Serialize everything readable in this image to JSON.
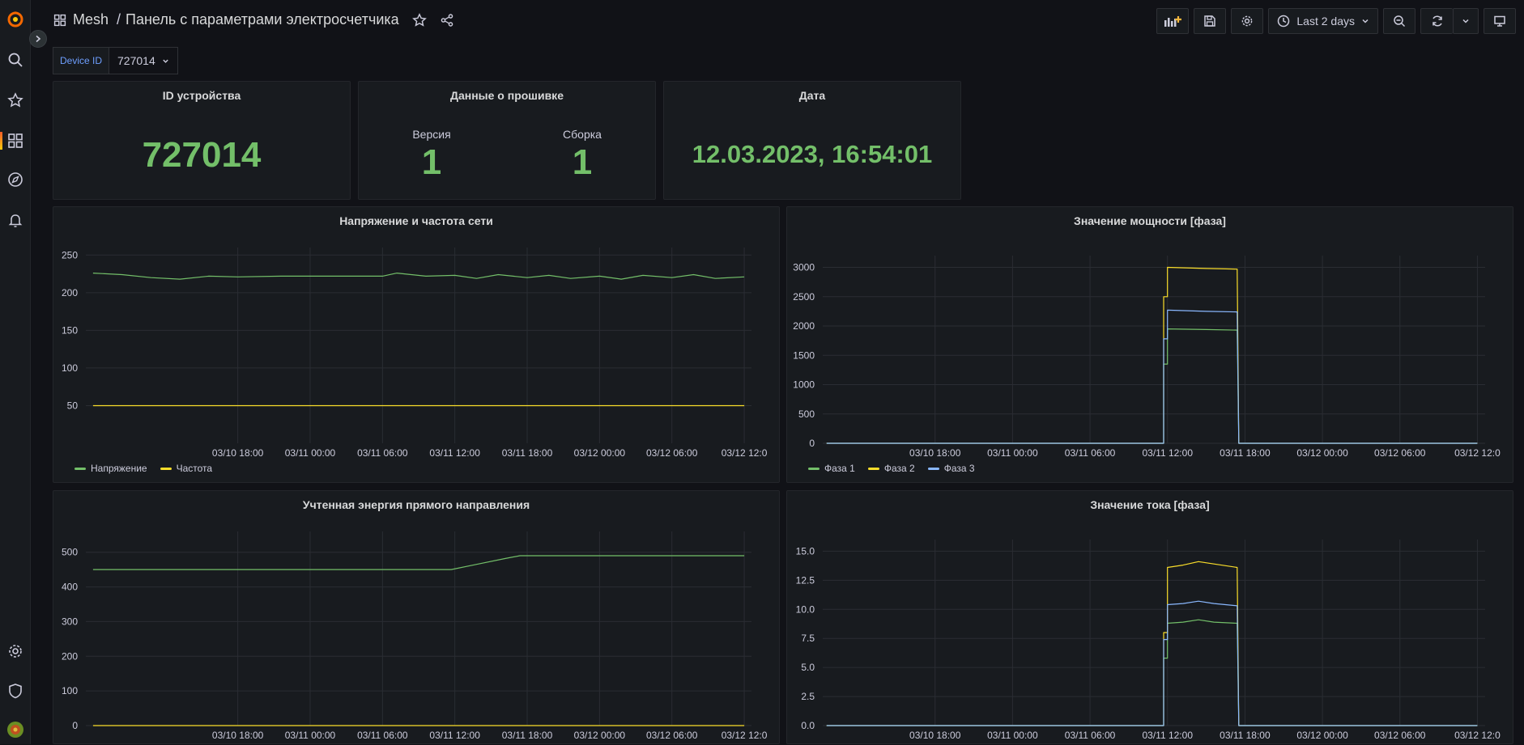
{
  "sidebar": {
    "items": [
      {
        "icon": "search-icon"
      },
      {
        "icon": "star-icon"
      },
      {
        "icon": "dashboards-icon"
      },
      {
        "icon": "explore-icon"
      },
      {
        "icon": "bell-icon"
      },
      {
        "icon": "gear-icon"
      },
      {
        "icon": "shield-icon"
      },
      {
        "icon": "avatar"
      }
    ]
  },
  "header": {
    "folder": "Mesh",
    "separator": "/",
    "title": "Панель с параметрами электросчетчика",
    "time_range": "Last 2 days"
  },
  "variables": {
    "label": "Device ID",
    "value": "727014"
  },
  "stats": {
    "device": {
      "title": "ID устройства",
      "value": "727014"
    },
    "firmware": {
      "title": "Данные о прошивке",
      "version_label": "Версия",
      "version_value": "1",
      "build_label": "Сборка",
      "build_value": "1"
    },
    "date": {
      "title": "Дата",
      "value": "12.03.2023, 16:54:01"
    }
  },
  "colors": {
    "green": "#73bf69",
    "yellow": "#fade2a",
    "blue": "#8ab8ff",
    "background": "#111217",
    "panel": "#181b1f"
  },
  "chart_data": [
    {
      "id": "voltage",
      "type": "line",
      "title": "Напряжение и частота сети",
      "x": [
        "03/10 18:00",
        "03/11 00:00",
        "03/11 06:00",
        "03/11 12:00",
        "03/11 18:00",
        "03/12 00:00",
        "03/12 06:00",
        "03/12 12:0"
      ],
      "x_range": [
        -2.1,
        7.1
      ],
      "ylim": [
        0,
        260
      ],
      "yticks": [
        50,
        100,
        150,
        200,
        250
      ],
      "ytick_labels": [
        "50",
        "100",
        "150",
        "200",
        "250"
      ],
      "grid": true,
      "legend": "bottom-left",
      "series": [
        {
          "name": "Напряжение",
          "color": "green",
          "points": [
            [
              -2.0,
              226
            ],
            [
              -1.6,
              224
            ],
            [
              -1.2,
              220
            ],
            [
              -0.8,
              218
            ],
            [
              -0.4,
              222
            ],
            [
              0.0,
              221
            ],
            [
              0.6,
              222
            ],
            [
              1.0,
              222
            ],
            [
              1.5,
              222
            ],
            [
              2.0,
              222
            ],
            [
              2.2,
              226
            ],
            [
              2.6,
              222
            ],
            [
              3.0,
              223
            ],
            [
              3.3,
              219
            ],
            [
              3.6,
              224
            ],
            [
              4.0,
              220
            ],
            [
              4.3,
              223
            ],
            [
              4.6,
              219
            ],
            [
              5.0,
              222
            ],
            [
              5.3,
              218
            ],
            [
              5.6,
              223
            ],
            [
              6.0,
              220
            ],
            [
              6.3,
              224
            ],
            [
              6.6,
              219
            ],
            [
              7.0,
              221
            ]
          ]
        },
        {
          "name": "Частота",
          "color": "yellow",
          "points": [
            [
              -2.0,
              50
            ],
            [
              7.0,
              50
            ]
          ]
        }
      ]
    },
    {
      "id": "power",
      "type": "line",
      "title": "Значение мощности [фаза]",
      "x": [
        "03/10 18:00",
        "03/11 00:00",
        "03/11 06:00",
        "03/11 12:00",
        "03/11 18:00",
        "03/12 00:00",
        "03/12 06:00",
        "03/12 12:0"
      ],
      "x_range": [
        -1.45,
        7.1
      ],
      "ylim": [
        0,
        3200
      ],
      "yticks": [
        0,
        500,
        1000,
        1500,
        2000,
        2500,
        3000
      ],
      "ytick_labels": [
        "0",
        "500",
        "1000",
        "1500",
        "2000",
        "2500",
        "3000"
      ],
      "grid": true,
      "legend": "bottom-left",
      "series": [
        {
          "name": "Фаза 1",
          "color": "green",
          "points": [
            [
              -1.4,
              0
            ],
            [
              2.95,
              0
            ],
            [
              2.95,
              1350
            ],
            [
              3.0,
              1350
            ],
            [
              3.0,
              1950
            ],
            [
              3.5,
              1940
            ],
            [
              3.9,
              1930
            ],
            [
              3.92,
              0
            ],
            [
              7.0,
              0
            ]
          ]
        },
        {
          "name": "Фаза 2",
          "color": "yellow",
          "points": [
            [
              -1.4,
              0
            ],
            [
              2.95,
              0
            ],
            [
              2.95,
              2500
            ],
            [
              3.0,
              2500
            ],
            [
              3.0,
              3000
            ],
            [
              3.5,
              2980
            ],
            [
              3.9,
              2970
            ],
            [
              3.92,
              0
            ],
            [
              7.0,
              0
            ]
          ]
        },
        {
          "name": "Фаза 3",
          "color": "blue",
          "points": [
            [
              -1.4,
              0
            ],
            [
              2.95,
              0
            ],
            [
              2.95,
              1780
            ],
            [
              3.0,
              1780
            ],
            [
              3.0,
              2270
            ],
            [
              3.5,
              2250
            ],
            [
              3.9,
              2240
            ],
            [
              3.92,
              0
            ],
            [
              7.0,
              0
            ]
          ]
        }
      ]
    },
    {
      "id": "energy",
      "type": "line",
      "title": "Учтенная энергия прямого направления",
      "x": [
        "03/10 18:00",
        "03/11 00:00",
        "03/11 06:00",
        "03/11 12:00",
        "03/11 18:00",
        "03/12 00:00",
        "03/12 06:00",
        "03/12 12:0"
      ],
      "x_range": [
        -2.1,
        7.1
      ],
      "ylim": [
        0,
        560
      ],
      "yticks": [
        0,
        100,
        200,
        300,
        400,
        500
      ],
      "ytick_labels": [
        "0",
        "100",
        "200",
        "300",
        "400",
        "500"
      ],
      "grid": true,
      "legend": "",
      "series": [
        {
          "name": "",
          "color": "green",
          "points": [
            [
              -2.0,
              450
            ],
            [
              2.95,
              450
            ],
            [
              3.3,
              465
            ],
            [
              3.7,
              482
            ],
            [
              3.9,
              490
            ],
            [
              7.0,
              490
            ]
          ]
        },
        {
          "name": "",
          "color": "yellow",
          "points": [
            [
              -2.0,
              0
            ],
            [
              7.0,
              0
            ]
          ]
        }
      ]
    },
    {
      "id": "current",
      "type": "line",
      "title": "Значение тока [фаза]",
      "x": [
        "03/10 18:00",
        "03/11 00:00",
        "03/11 06:00",
        "03/11 12:00",
        "03/11 18:00",
        "03/12 00:00",
        "03/12 06:00",
        "03/12 12:0"
      ],
      "x_range": [
        -1.45,
        7.1
      ],
      "ylim": [
        0,
        16
      ],
      "yticks": [
        0,
        2.5,
        5,
        7.5,
        10,
        12.5,
        15
      ],
      "ytick_labels": [
        "0.0",
        "2.5",
        "5.0",
        "7.5",
        "10.0",
        "12.5",
        "15.0"
      ],
      "grid": true,
      "legend": "",
      "series": [
        {
          "name": "",
          "color": "green",
          "points": [
            [
              -1.4,
              0
            ],
            [
              2.95,
              0
            ],
            [
              2.95,
              5.8
            ],
            [
              3.0,
              5.8
            ],
            [
              3.0,
              8.8
            ],
            [
              3.2,
              8.9
            ],
            [
              3.4,
              9.1
            ],
            [
              3.6,
              8.9
            ],
            [
              3.9,
              8.8
            ],
            [
              3.92,
              0
            ],
            [
              7.0,
              0
            ]
          ]
        },
        {
          "name": "",
          "color": "yellow",
          "points": [
            [
              -1.4,
              0
            ],
            [
              2.95,
              0
            ],
            [
              2.95,
              8.0
            ],
            [
              3.0,
              8.0
            ],
            [
              3.0,
              13.6
            ],
            [
              3.2,
              13.8
            ],
            [
              3.4,
              14.1
            ],
            [
              3.6,
              13.9
            ],
            [
              3.9,
              13.6
            ],
            [
              3.92,
              0
            ],
            [
              7.0,
              0
            ]
          ]
        },
        {
          "name": "",
          "color": "blue",
          "points": [
            [
              -1.4,
              0
            ],
            [
              2.95,
              0
            ],
            [
              2.95,
              7.4
            ],
            [
              3.0,
              7.4
            ],
            [
              3.0,
              10.4
            ],
            [
              3.2,
              10.5
            ],
            [
              3.4,
              10.7
            ],
            [
              3.6,
              10.5
            ],
            [
              3.9,
              10.3
            ],
            [
              3.92,
              0
            ],
            [
              7.0,
              0
            ]
          ]
        }
      ]
    }
  ]
}
